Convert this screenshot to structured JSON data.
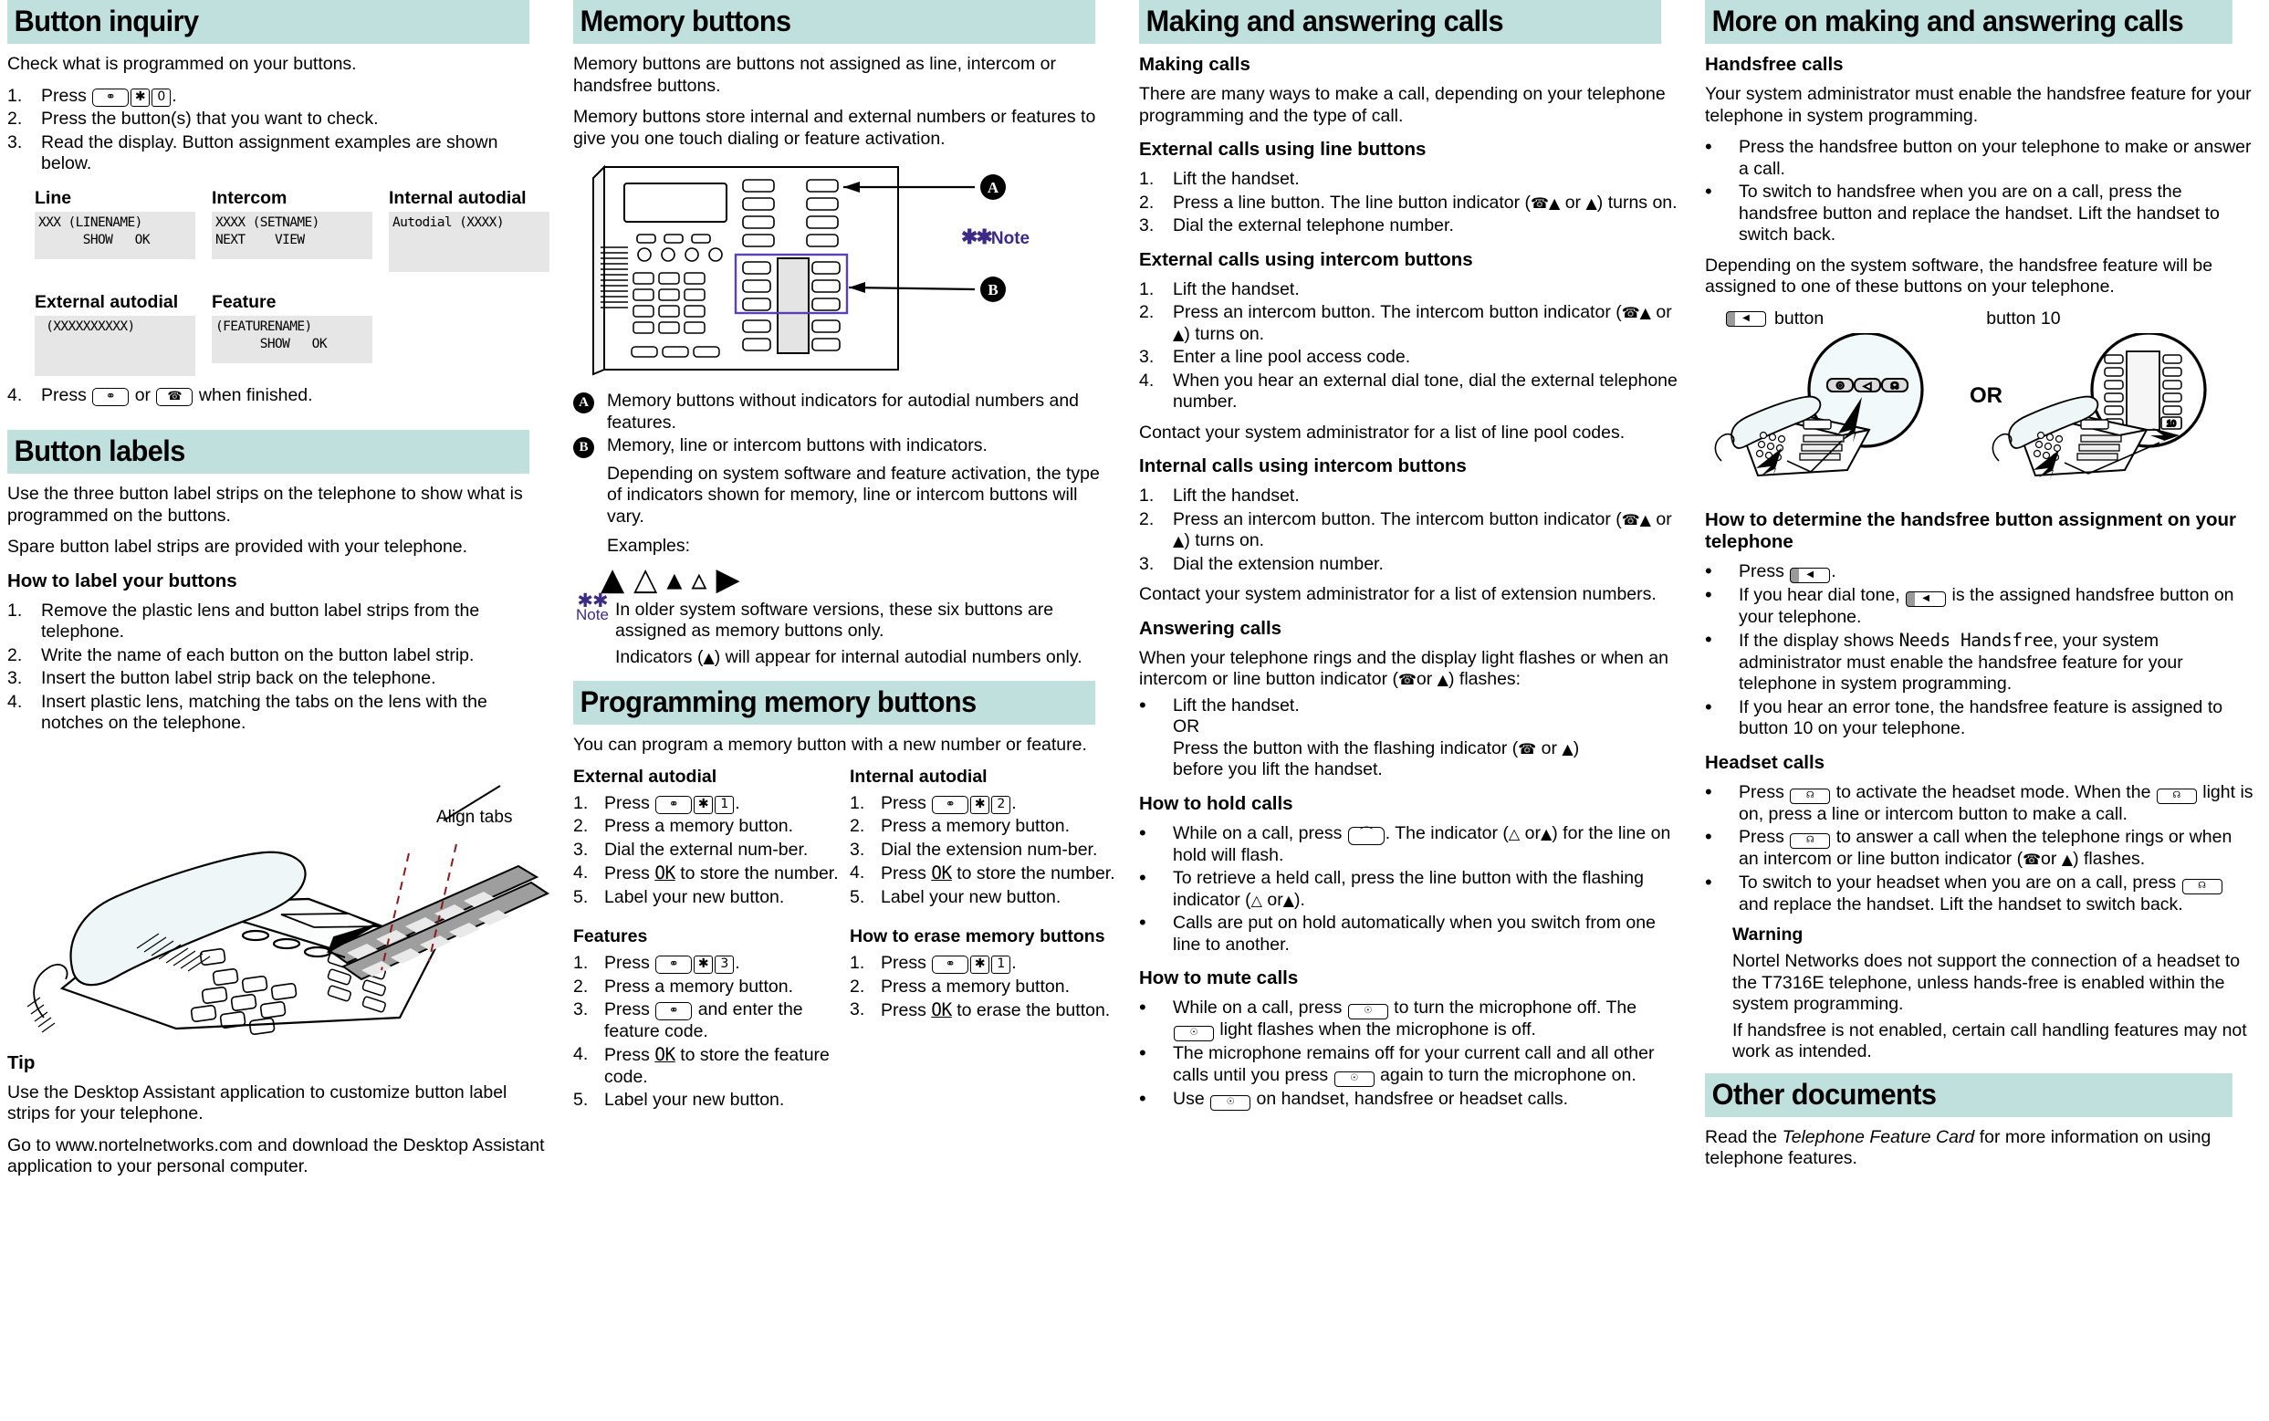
{
  "columns": {
    "c1": {
      "section1_title": "Button inquiry",
      "intro": "Check what is programmed on your buttons.",
      "steps": [
        "Press",
        "Press the button(s) that you want to check.",
        "Read the display. Button assignment examples are shown below.",
        "Press"
      ],
      "step1_suffix": ".",
      "step4_mid": "or",
      "step4_suffix": "when finished.",
      "displays": [
        {
          "label": "Line",
          "line1": "XXX (LINENAME)",
          "line2": "      SHOW   OK"
        },
        {
          "label": "Intercom",
          "line1": "XXXX (SETNAME)",
          "line2": "NEXT    VIEW"
        },
        {
          "label": "Internal autodial",
          "line1": "Autodial (XXXX)",
          "line2": ""
        },
        {
          "label": "External autodial",
          "line1": " (XXXXXXXXXX)",
          "line2": ""
        },
        {
          "label": "Feature",
          "line1": "(FEATURENAME)",
          "line2": "      SHOW   OK"
        }
      ],
      "section2_title": "Button labels",
      "labels_p1": "Use the three button label strips on the telephone to show what is programmed on the buttons.",
      "labels_p2": "Spare button label strips are provided with your telephone.",
      "labels_h3": "How to label your buttons",
      "labels_steps": [
        "Remove the plastic lens and button label strips from the telephone.",
        "Write the name of each button on the button label strip.",
        "Insert the button label strip back on the telephone.",
        "Insert plastic lens, matching the tabs on the lens with the notches on the telephone."
      ],
      "align_tabs_label": "Align tabs",
      "tip_title": "Tip",
      "tip_p1": "Use the Desktop Assistant application to customize button label strips for your telephone.",
      "tip_p2": "Go to www.nortelnetworks.com and download the Desktop Assistant application to your personal computer."
    },
    "c2": {
      "section1_title": "Memory buttons",
      "p1": "Memory buttons are buttons not assigned as line, intercom or handsfree buttons.",
      "p2": "Memory buttons store internal and external numbers or features to give you one touch dialing or feature activation.",
      "callout_a_letter": "A",
      "callout_b_letter": "B",
      "callout_a_text": "Memory buttons without indicators for autodial numbers and features.",
      "callout_b_text": "Memory, line or intercom buttons with indicators.",
      "callout_b_text2": "Depending on system software and feature activation, the type of indicators shown for memory, line or intercom buttons will vary.",
      "examples_label": "Examples:",
      "note_label": "Note",
      "note_text1": "In older system software versions, these six buttons are assigned as memory buttons only.",
      "note_text2_pre": "Indicators (",
      "note_text2_post": ") will appear for internal autodial numbers only.",
      "diagram_note_label": "Note",
      "diagram_a": "A",
      "diagram_b": "B",
      "section2_title": "Programming memory buttons",
      "prog_intro": "You can program a memory button with a new number or feature.",
      "ext_autodial_title": "External autodial",
      "ext_autodial_steps": [
        "Press",
        "Press a memory button.",
        "Dial the external num-ber.",
        "Press",
        "Label your new button."
      ],
      "int_autodial_title": "Internal autodial",
      "int_autodial_steps": [
        "Press",
        "Press a memory button.",
        "Dial the extension num-ber.",
        "Press",
        "Label your new button."
      ],
      "store_number_text": "to store the number.",
      "features_title": "Features",
      "features_steps": [
        "Press",
        "Press a memory button.",
        "Press",
        "Press",
        "Label your new button."
      ],
      "features_step3_tail": "and enter the feature code.",
      "features_step4_tail": "to store the feature code.",
      "erase_title": "How to erase memory buttons",
      "erase_steps": [
        "Press",
        "Press a memory button.",
        "Press"
      ],
      "erase_step3_tail": "to erase the button.",
      "ok_key": "OK"
    },
    "c3": {
      "section_title": "Making and answering calls",
      "making_calls_title": "Making calls",
      "making_calls_p": "There are many ways to make a call, depending on your telephone programming and the type of call.",
      "ext_line_title": "External calls using line buttons",
      "ext_line_steps": [
        "Lift the handset.",
        "Press a line button. The line button indicator (",
        "Dial the external telephone number."
      ],
      "ext_line_step2_mid": " or ",
      "ext_line_step2_tail": ") turns on.",
      "ext_intercom_title": "External calls using intercom buttons",
      "ext_intercom_steps": [
        "Lift the handset.",
        "Press an intercom button. The intercom button indicator (",
        "Enter a line pool access code.",
        "When you hear an external dial tone, dial the external telephone number."
      ],
      "ext_intercom_p": "Contact your system administrator for a list of line pool codes.",
      "int_intercom_title": "Internal calls using intercom buttons",
      "int_intercom_steps": [
        "Lift the handset.",
        "Press an intercom button. The intercom button indicator (",
        "Dial the extension number."
      ],
      "int_intercom_p": "Contact your system administrator for a list of extension numbers.",
      "answering_title": "Answering calls",
      "answering_p_pre": "When your telephone rings and the display light flashes or when an intercom or line button  indicator (",
      "answering_p_post": ") flashes:",
      "answering_b1_l1": "Lift the handset.",
      "answering_b1_l2": "OR",
      "answering_b1_l3_pre": "Press the button with the flashing indicator (",
      "answering_b1_l3_post": ")",
      "answering_b1_l4": "before you lift the handset.",
      "hold_title": "How to hold calls",
      "hold_b1_pre": "While on a call, press",
      "hold_b1_mid": ". The indicator (",
      "hold_b1_post": ") for the line on hold will flash.",
      "hold_b2_pre": "To retrieve a held call, press the line button with the flashing indicator (",
      "hold_b2_post": ").",
      "hold_b3": "Calls are put on hold automatically when you switch from one line to another.",
      "mute_title": "How to mute calls",
      "mute_b1_pre": "While on a call, press",
      "mute_b1_mid": "to turn the microphone off. The",
      "mute_b1_post": "light flashes when the microphone is off.",
      "mute_b2_pre": "The microphone remains off for your current call and all other calls until you press",
      "mute_b2_post": "again to turn the microphone on.",
      "mute_b3_pre": "Use",
      "mute_b3_post": "on handset, handsfree or headset calls.",
      "or_word": "or"
    },
    "c4": {
      "section_title": "More on making and answering calls",
      "handsfree_title": "Handsfree calls",
      "handsfree_p": "Your system administrator must enable the handsfree feature for your telephone in system programming.",
      "handsfree_b1": "Press the handsfree button on your telephone to make or answer a call.",
      "handsfree_b2": "To switch to handsfree when you are on a call, press the handsfree button and replace the handset. Lift the handset to switch back.",
      "handsfree_p2": "Depending on the system software, the handsfree feature will be assigned to one of these buttons on your telephone.",
      "button_label": "button",
      "button10_label": "button 10",
      "or_word": "OR",
      "button10_num": "10",
      "determine_title": "How to determine the handsfree button assignment on your telephone",
      "determine_b1": "Press",
      "determine_b1_tail": ".",
      "determine_b2_pre": "If you hear dial tone,",
      "determine_b2_post": "is the assigned handsfree button on your telephone.",
      "determine_b3_pre": "If the display shows",
      "determine_b3_mono": "Needs Handsfree",
      "determine_b3_post": ", your system administrator must enable the handsfree feature for your telephone in system programming.",
      "determine_b4": "If you hear an error tone, the handsfree feature is assigned to button 10 on your telephone.",
      "headset_title": "Headset calls",
      "headset_b1_pre": "Press",
      "headset_b1_mid": "to activate the headset mode. When the",
      "headset_b1_post": "light is on, press a line or intercom button to make a call.",
      "headset_b2_pre": "Press",
      "headset_b2_mid": "to answer a call when the telephone rings or when an intercom or line button indicator (",
      "headset_b2_post": ") flashes.",
      "headset_b3_pre": "To switch to your headset when you are on a call, press",
      "headset_b3_post": "and replace the handset. Lift the handset to switch back.",
      "warning_title": "Warning",
      "warning_p1": "Nortel Networks does not support the connection of a headset to the T7316E telephone, unless hands-free is enabled within the system programming.",
      "warning_p2": "If handsfree is not enabled, certain call handling features may not work as intended.",
      "other_docs_title": "Other documents",
      "other_docs_pre": "Read the",
      "other_docs_em": "Telephone Feature Card",
      "other_docs_post": "for more information on using telephone features."
    }
  },
  "colors": {
    "band": "#bfe0dd",
    "screen_bg": "#e6e6e6",
    "note_purple": "#3b2a86",
    "text": "#000000"
  },
  "keys": {
    "feature": "⚭",
    "star": "✱",
    "zero": "0",
    "one": "1",
    "two": "2",
    "three": "3",
    "release": "☎",
    "hold": "⌣",
    "mute": "·♀·",
    "handsfree": "◀",
    "headset": "♁"
  }
}
